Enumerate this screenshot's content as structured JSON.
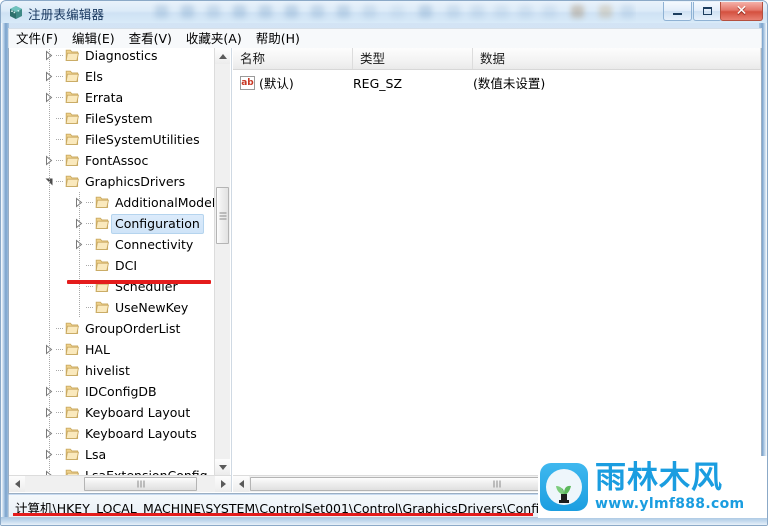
{
  "window": {
    "title": "注册表编辑器",
    "icon": "regedit-icon",
    "buttons": {
      "minimize": "最小化",
      "maximize": "最大化",
      "close": "关闭"
    },
    "accent_color": "#1a9de0",
    "annotation_color": "#e41c1c"
  },
  "menu": {
    "items": [
      {
        "label": "文件(F)",
        "name": "menu-file"
      },
      {
        "label": "编辑(E)",
        "name": "menu-edit"
      },
      {
        "label": "查看(V)",
        "name": "menu-view"
      },
      {
        "label": "收藏夹(A)",
        "name": "menu-favorites"
      },
      {
        "label": "帮助(H)",
        "name": "menu-help"
      }
    ]
  },
  "tree": {
    "items": [
      {
        "label": "Diagnostics",
        "depth": 0,
        "state": "collapsed",
        "selected": false
      },
      {
        "label": "Els",
        "depth": 0,
        "state": "collapsed",
        "selected": false
      },
      {
        "label": "Errata",
        "depth": 0,
        "state": "collapsed",
        "selected": false
      },
      {
        "label": "FileSystem",
        "depth": 0,
        "state": "leaf",
        "selected": false
      },
      {
        "label": "FileSystemUtilities",
        "depth": 0,
        "state": "leaf",
        "selected": false
      },
      {
        "label": "FontAssoc",
        "depth": 0,
        "state": "collapsed",
        "selected": false
      },
      {
        "label": "GraphicsDrivers",
        "depth": 0,
        "state": "expanded",
        "selected": false
      },
      {
        "label": "AdditionalModeLists",
        "depth": 1,
        "state": "collapsed",
        "selected": false
      },
      {
        "label": "Configuration",
        "depth": 1,
        "state": "collapsed",
        "selected": true
      },
      {
        "label": "Connectivity",
        "depth": 1,
        "state": "collapsed",
        "selected": false
      },
      {
        "label": "DCI",
        "depth": 1,
        "state": "leaf",
        "selected": false
      },
      {
        "label": "Scheduler",
        "depth": 1,
        "state": "leaf",
        "selected": false
      },
      {
        "label": "UseNewKey",
        "depth": 1,
        "state": "leaf",
        "selected": false
      },
      {
        "label": "GroupOrderList",
        "depth": 0,
        "state": "leaf",
        "selected": false
      },
      {
        "label": "HAL",
        "depth": 0,
        "state": "collapsed",
        "selected": false
      },
      {
        "label": "hivelist",
        "depth": 0,
        "state": "leaf",
        "selected": false
      },
      {
        "label": "IDConfigDB",
        "depth": 0,
        "state": "collapsed",
        "selected": false
      },
      {
        "label": "Keyboard Layout",
        "depth": 0,
        "state": "collapsed",
        "selected": false
      },
      {
        "label": "Keyboard Layouts",
        "depth": 0,
        "state": "collapsed",
        "selected": false
      },
      {
        "label": "Lsa",
        "depth": 0,
        "state": "collapsed",
        "selected": false
      },
      {
        "label": "LsaExtensionConfig",
        "depth": 0,
        "state": "collapsed",
        "selected": false
      }
    ]
  },
  "values": {
    "columns": [
      {
        "label": "名称",
        "name": "column-name"
      },
      {
        "label": "类型",
        "name": "column-type"
      },
      {
        "label": "数据",
        "name": "column-data"
      }
    ],
    "rows": [
      {
        "icon": "string-value-icon",
        "icon_text": "ab",
        "name": "(默认)",
        "type": "REG_SZ",
        "data": "(数值未设置)"
      }
    ]
  },
  "status": {
    "path": "计算机\\HKEY_LOCAL_MACHINE\\SYSTEM\\ControlSet001\\Control\\GraphicsDrivers\\Configurati"
  },
  "watermark": {
    "brand": "雨林木风",
    "url": "www.ylmf888.com",
    "logo": "sprout-logo"
  }
}
